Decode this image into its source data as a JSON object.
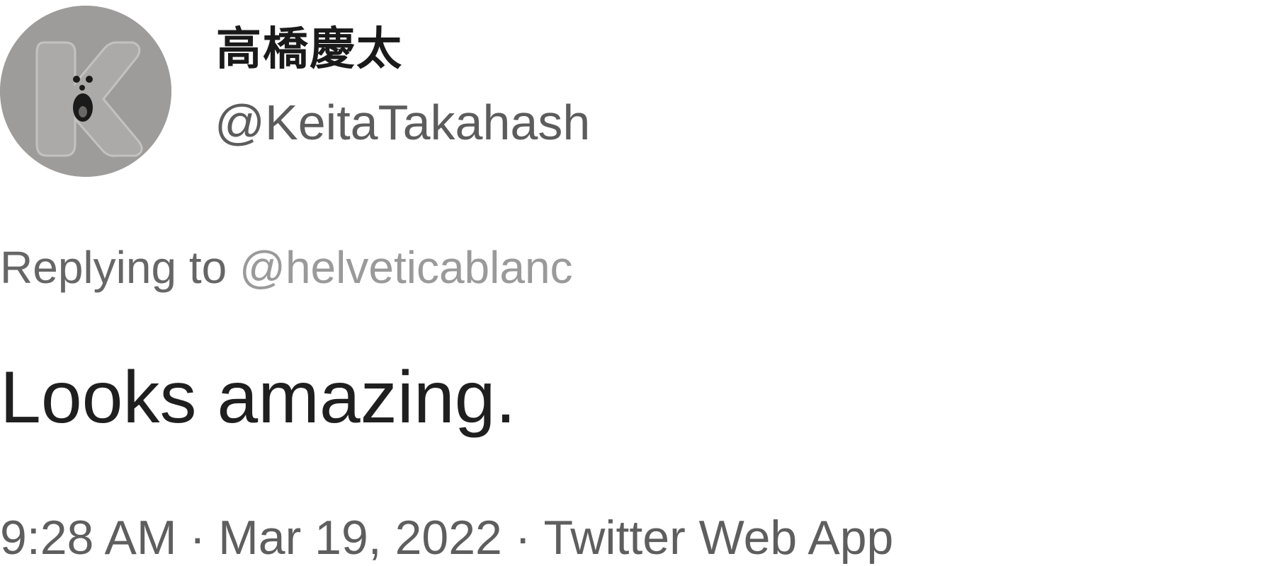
{
  "author": {
    "display_name": "高橋慶太",
    "handle": "@KeitaTakahash",
    "avatar_icon": "k-character-avatar-icon"
  },
  "reply": {
    "prefix": "Replying to",
    "mention": "@helveticablanc"
  },
  "tweet": {
    "text": "Looks amazing."
  },
  "meta": {
    "time": "9:28 AM",
    "separator": "·",
    "date": "Mar 19, 2022",
    "source": "Twitter Web App"
  },
  "colors": {
    "avatar_bg": "#9e9c9a",
    "text": "#1f1f1f",
    "secondary": "#5e5e5e",
    "mention": "#9a9a9a"
  }
}
